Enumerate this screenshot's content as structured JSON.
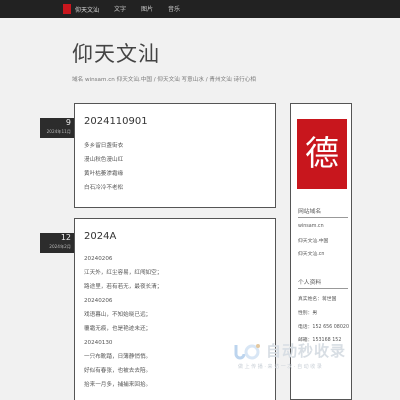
{
  "topbar": {
    "brand": "仰天文汕",
    "nav": [
      "文字",
      "图片",
      "音乐"
    ]
  },
  "site": {
    "title": "仰天文汕",
    "subtitle": "域名 winsam.cn 仰天文汕.中国 / 仰天文汕 写意山水 / 青州文汕 诗行心相"
  },
  "posts": [
    {
      "day": "9",
      "ym": "2024年11月",
      "title": "2024110901",
      "lines": [
        "多乡留日盏街衣",
        "漫山秋色漫山红",
        "黄叶枯萎渗霜缘",
        "白石冷冷不老松"
      ]
    },
    {
      "day": "12",
      "ym": "2024年2月",
      "title": "2024A",
      "lines": [
        "20240206",
        "江天外，红尘容易，红闯如空；",
        "路途里，若有若无，最夜长清；",
        "20240206",
        "戏语暮山，不知始晓已远；",
        "覆霜无痕，也是艳迹未还；",
        "20240130",
        "一只布靴踏，日薄静悄悄。",
        "好似有春张，也被去去陪。",
        "抬来一月多，捕捕来回拾。"
      ]
    }
  ],
  "sidebar": {
    "logo_glyph": "德",
    "site_name_head": "网站域名",
    "domains": [
      "winsam.cn",
      "仰天文汕.中国",
      "仰天文汕.cn"
    ],
    "profile_head": "个人资料",
    "profile": [
      "真实姓名：蒋世国",
      "性别：男",
      "电话：152 656 08020",
      "邮箱：153168 152"
    ]
  },
  "watermark": {
    "text": "自动秒收录",
    "tagline": "做 上 传 播 · 来 访 一 次 · 自 动 收 录"
  },
  "colors": {
    "accent": "#c8161d",
    "topbar": "#222222"
  }
}
